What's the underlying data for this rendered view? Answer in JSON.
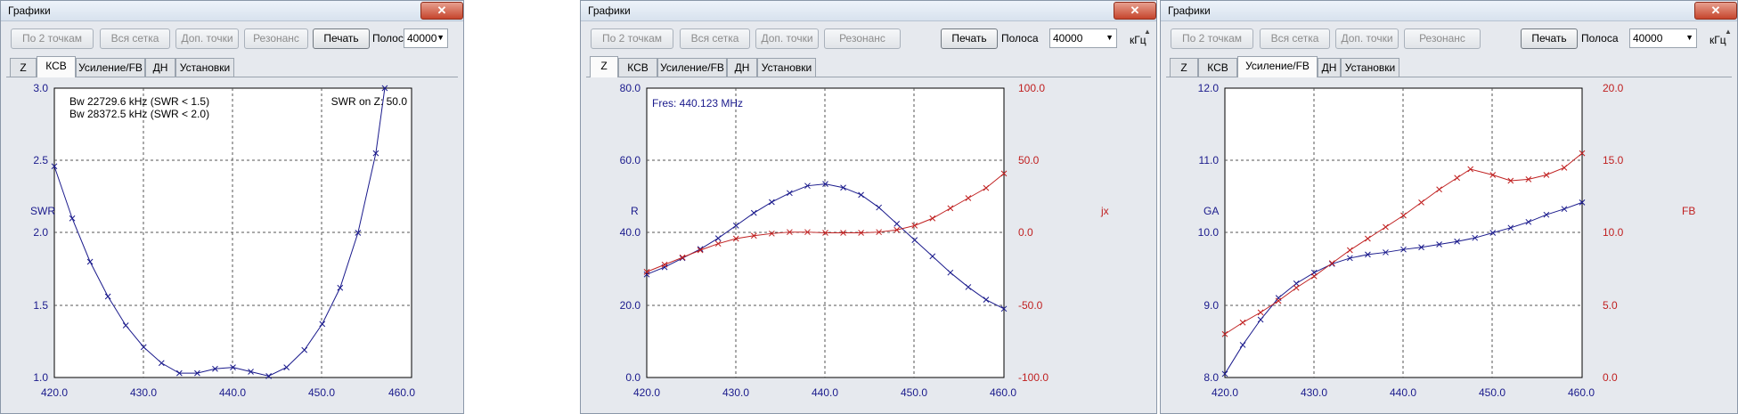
{
  "windows": [
    {
      "title": "Графики",
      "close_icon": "close-icon",
      "toolbar": {
        "btn_two_points": "По 2 точкам",
        "btn_full_grid": "Вся сетка",
        "btn_extra_points": "Доп. точки",
        "btn_resonance": "Резонанс",
        "btn_print": "Печать",
        "band_label": "Полоса",
        "band_value": "40000",
        "band_unit": "кГц"
      },
      "tabs": [
        "Z",
        "КСВ",
        "Усиление/FB",
        "ДН",
        "Установки"
      ],
      "selected_tab": "КСВ"
    },
    {
      "title": "Графики",
      "close_icon": "close-icon",
      "toolbar": {
        "btn_two_points": "По 2 точкам",
        "btn_full_grid": "Вся сетка",
        "btn_extra_points": "Доп. точки",
        "btn_resonance": "Резонанс",
        "btn_print": "Печать",
        "band_label": "Полоса",
        "band_value": "40000",
        "band_unit": "кГц"
      },
      "tabs": [
        "Z",
        "КСВ",
        "Усиление/FB",
        "ДН",
        "Установки"
      ],
      "selected_tab": "Z"
    },
    {
      "title": "Графики",
      "close_icon": "close-icon",
      "toolbar": {
        "btn_two_points": "По 2 точкам",
        "btn_full_grid": "Вся сетка",
        "btn_extra_points": "Доп. точки",
        "btn_resonance": "Резонанс",
        "btn_print": "Печать",
        "band_label": "Полоса",
        "band_value": "40000",
        "band_unit": "кГц"
      },
      "tabs": [
        "Z",
        "КСВ",
        "Усиление/FB",
        "ДН",
        "Установки"
      ],
      "selected_tab": "Усиление/FB"
    }
  ],
  "chart_data": [
    {
      "type": "line",
      "xlim": [
        420,
        460
      ],
      "x_ticks": [
        "420.0",
        "430.0",
        "440.0",
        "450.0",
        "460.0"
      ],
      "ylim": [
        1.0,
        3.0
      ],
      "y_ticks": [
        "1.0",
        "1.5",
        "2.0",
        "2.5",
        "3.0"
      ],
      "ylabel": "SWR",
      "grid": true,
      "annotations": {
        "bw1": "Bw 22729.6 kHz (SWR < 1.5)",
        "bw2": "Bw 28372.5 kHz (SWR < 2.0)",
        "swr_on": "SWR on Z: 50.0"
      },
      "colors": {
        "series": "#1a1a8c"
      },
      "series": [
        {
          "x": [
            420,
            422,
            424,
            426,
            428,
            430,
            432,
            434,
            436,
            438,
            440,
            442,
            444,
            446,
            448,
            450,
            452,
            454,
            456,
            457
          ],
          "values": [
            2.46,
            2.1,
            1.8,
            1.56,
            1.36,
            1.21,
            1.1,
            1.03,
            1.03,
            1.06,
            1.07,
            1.04,
            1.01,
            1.07,
            1.19,
            1.37,
            1.62,
            2.0,
            2.55,
            3.0
          ]
        }
      ]
    },
    {
      "type": "line",
      "xlim": [
        420,
        460
      ],
      "x_ticks": [
        "420.0",
        "430.0",
        "440.0",
        "450.0",
        "460.0"
      ],
      "ylim": [
        0,
        80
      ],
      "y_ticks": [
        "0.0",
        "20.0",
        "40.0",
        "60.0",
        "80.0"
      ],
      "ylabel": "R",
      "y2lim": [
        -100,
        100
      ],
      "y2_ticks": [
        "-100.0",
        "-50.0",
        "0.0",
        "50.0",
        "100.0"
      ],
      "y2label": "jx",
      "grid": true,
      "annotations": {
        "fres": "Fres: 440.123 MHz"
      },
      "colors": {
        "r": "#1a1a8c",
        "jx": "#c02020"
      },
      "series": [
        {
          "axis": "left",
          "x": [
            420,
            422,
            424,
            426,
            428,
            430,
            432,
            434,
            436,
            438,
            440,
            442,
            444,
            446,
            448,
            450,
            452,
            454,
            456,
            458,
            460
          ],
          "values": [
            28.5,
            30.5,
            33,
            35.5,
            38.5,
            42,
            45.5,
            48.5,
            51,
            53,
            53.5,
            52.5,
            50.5,
            47,
            42.5,
            38,
            33.5,
            29,
            25,
            21.5,
            19
          ]
        },
        {
          "axis": "right",
          "x": [
            420,
            422,
            424,
            426,
            428,
            430,
            432,
            434,
            436,
            438,
            440,
            442,
            444,
            446,
            448,
            450,
            452,
            454,
            456,
            458,
            460
          ],
          "values": [
            -27,
            -22,
            -17,
            -12,
            -7.5,
            -4,
            -2,
            -0.5,
            0.5,
            0.5,
            0,
            0,
            0,
            0.5,
            2,
            5,
            10,
            17,
            24,
            31,
            41
          ]
        }
      ]
    },
    {
      "type": "line",
      "xlim": [
        420,
        460
      ],
      "x_ticks": [
        "420.0",
        "430.0",
        "440.0",
        "450.0",
        "460.0"
      ],
      "ylim": [
        8.0,
        12.0
      ],
      "y_ticks": [
        "8.0",
        "9.0",
        "10.0",
        "11.0",
        "12.0"
      ],
      "ylabel": "GA",
      "y2lim": [
        0,
        20
      ],
      "y2_ticks": [
        "0.0",
        "5.0",
        "10.0",
        "15.0",
        "20.0"
      ],
      "y2label": "FB",
      "grid": true,
      "colors": {
        "ga": "#1a1a8c",
        "fb": "#c02020"
      },
      "series": [
        {
          "axis": "left",
          "x": [
            420,
            422,
            424,
            426,
            428,
            430,
            432,
            434,
            436,
            438,
            440,
            442,
            444,
            446,
            448,
            450,
            452,
            454,
            456,
            458,
            460
          ],
          "values": [
            8.05,
            8.45,
            8.8,
            9.1,
            9.3,
            9.45,
            9.57,
            9.65,
            9.7,
            9.73,
            9.77,
            9.8,
            9.84,
            9.88,
            9.93,
            10.0,
            10.07,
            10.15,
            10.25,
            10.33,
            10.42
          ]
        },
        {
          "axis": "right",
          "x": [
            420,
            422,
            424,
            426,
            428,
            430,
            432,
            434,
            436,
            438,
            440,
            442,
            444,
            446,
            447.5,
            450,
            452,
            454,
            456,
            458,
            460
          ],
          "values": [
            3.0,
            3.8,
            4.5,
            5.3,
            6.2,
            7.0,
            7.9,
            8.8,
            9.6,
            10.4,
            11.2,
            12.1,
            13.0,
            13.8,
            14.4,
            14.0,
            13.6,
            13.7,
            14.0,
            14.5,
            15.5
          ]
        }
      ]
    }
  ]
}
